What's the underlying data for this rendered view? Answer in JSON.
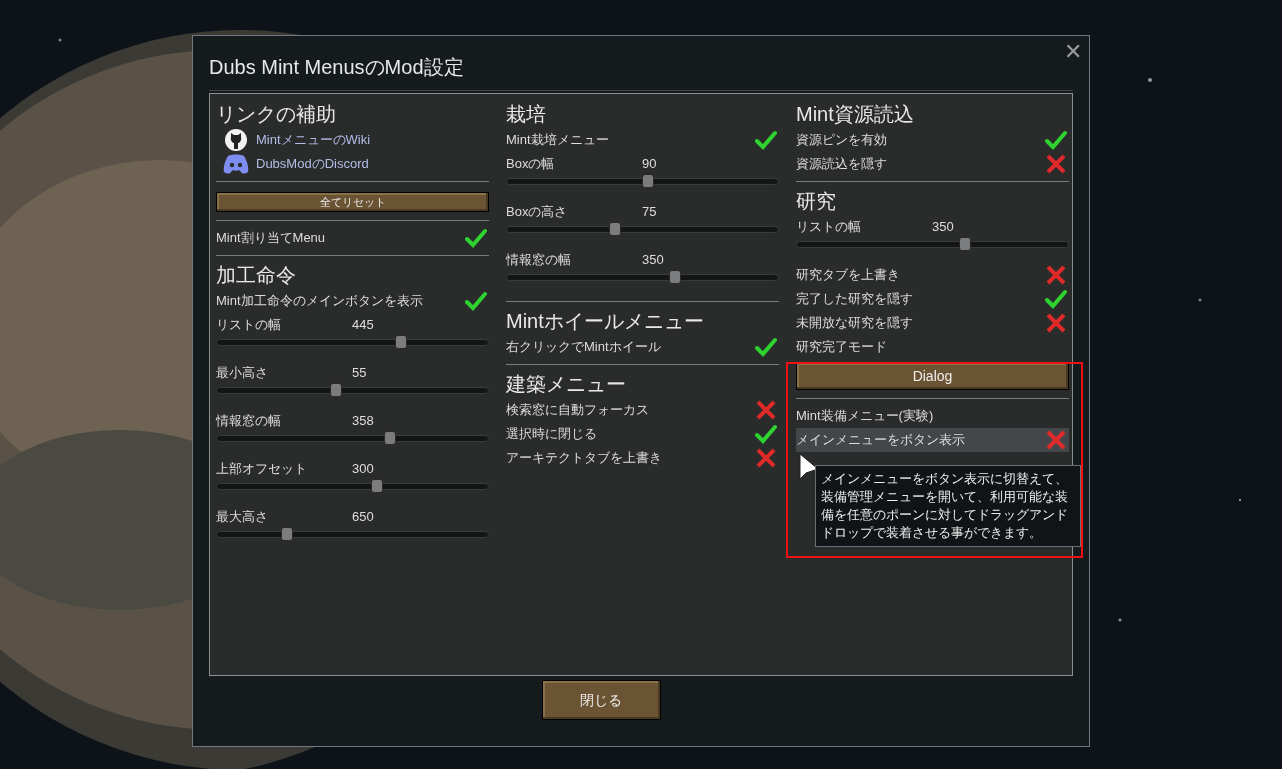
{
  "window": {
    "title": "Dubs Mint MenusのMod設定",
    "close_symbol": "✕"
  },
  "columns": [
    [
      {
        "items": [
          {
            "kind": "heading",
            "label": "リンクの補助"
          },
          {
            "kind": "link",
            "label": "MintメニューのWiki"
          },
          {
            "kind": "link",
            "label": "DubsModのDiscord"
          }
        ]
      },
      {
        "items": [
          {
            "kind": "compact_button",
            "label": "全てリセット"
          }
        ]
      },
      {
        "items": [
          {
            "kind": "toggle",
            "label": "Mint割り当てMenu",
            "checked": true,
            "hovered": false
          }
        ]
      },
      {
        "items": [
          {
            "kind": "heading",
            "label": "加工命令"
          },
          {
            "kind": "toggle",
            "label": "Mint加工命令のメインボタンを表示",
            "checked": true,
            "hovered": false
          },
          {
            "kind": "slider",
            "label": "リストの幅",
            "value": "445",
            "level": 0.68
          },
          {
            "kind": "slider",
            "label": "最小高さ",
            "value": "55",
            "level": 0.44
          },
          {
            "kind": "slider",
            "label": "情報窓の幅",
            "value": "358",
            "level": 0.64
          },
          {
            "kind": "slider",
            "label": "上部オフセット",
            "value": "300",
            "level": 0.59
          },
          {
            "kind": "slider",
            "label": "最大高さ",
            "value": "650",
            "level": 0.26
          }
        ]
      }
    ],
    [
      {
        "items": [
          {
            "kind": "heading",
            "label": "栽培"
          },
          {
            "kind": "toggle",
            "label": "Mint栽培メニュー",
            "checked": true,
            "hovered": false
          },
          {
            "kind": "slider",
            "label": "Boxの幅",
            "value": "90",
            "level": 0.52
          },
          {
            "kind": "slider",
            "label": "Boxの高さ",
            "value": "75",
            "level": 0.4
          },
          {
            "kind": "slider",
            "label": "情報窓の幅",
            "value": "350",
            "level": 0.62
          }
        ]
      },
      {
        "items": [
          {
            "kind": "heading",
            "label": "Mintホイールメニュー"
          },
          {
            "kind": "toggle",
            "label": "右クリックでMintホイール",
            "checked": true,
            "hovered": false
          }
        ]
      },
      {
        "items": [
          {
            "kind": "heading",
            "label": "建築メニュー"
          },
          {
            "kind": "toggle",
            "label": "検索窓に自動フォーカス",
            "checked": false,
            "hovered": false
          },
          {
            "kind": "toggle",
            "label": "選択時に閉じる",
            "checked": true,
            "hovered": false
          },
          {
            "kind": "toggle",
            "label": "アーキテクトタブを上書き",
            "checked": false,
            "hovered": false
          }
        ]
      }
    ],
    [
      {
        "items": [
          {
            "kind": "heading",
            "label": "Mint資源読込"
          },
          {
            "kind": "toggle",
            "label": "資源ピンを有効",
            "checked": true,
            "hovered": false
          },
          {
            "kind": "toggle",
            "label": "資源読込を隠す",
            "checked": false,
            "hovered": false
          }
        ]
      },
      {
        "items": [
          {
            "kind": "heading",
            "label": "研究"
          },
          {
            "kind": "slider",
            "label": "リストの幅",
            "value": "350",
            "level": 0.62
          },
          {
            "kind": "toggle",
            "label": "研究タブを上書き",
            "checked": false,
            "hovered": false
          },
          {
            "kind": "toggle",
            "label": "完了した研究を隠す",
            "checked": true,
            "hovered": false
          },
          {
            "kind": "toggle",
            "label": "未開放な研究を隠す",
            "checked": false,
            "hovered": false
          },
          {
            "kind": "label",
            "label": "研究完了モード"
          },
          {
            "kind": "button",
            "label": "Dialog"
          }
        ]
      },
      {
        "items": [
          {
            "kind": "label",
            "label": "Mint装備メニュー(実験)"
          },
          {
            "kind": "toggle",
            "label": "メインメニューをボタン表示",
            "checked": false,
            "hovered": true
          }
        ]
      }
    ]
  ],
  "tooltip": {
    "text": "メインメニューをボタン表示に切替えて、装備管理メニューを開いて、利用可能な装備を任意のポーンに対してドラッグアンドドロップで装着させる事ができます。"
  },
  "annotation_box": true,
  "footer": {
    "close_button": "閉じる"
  }
}
